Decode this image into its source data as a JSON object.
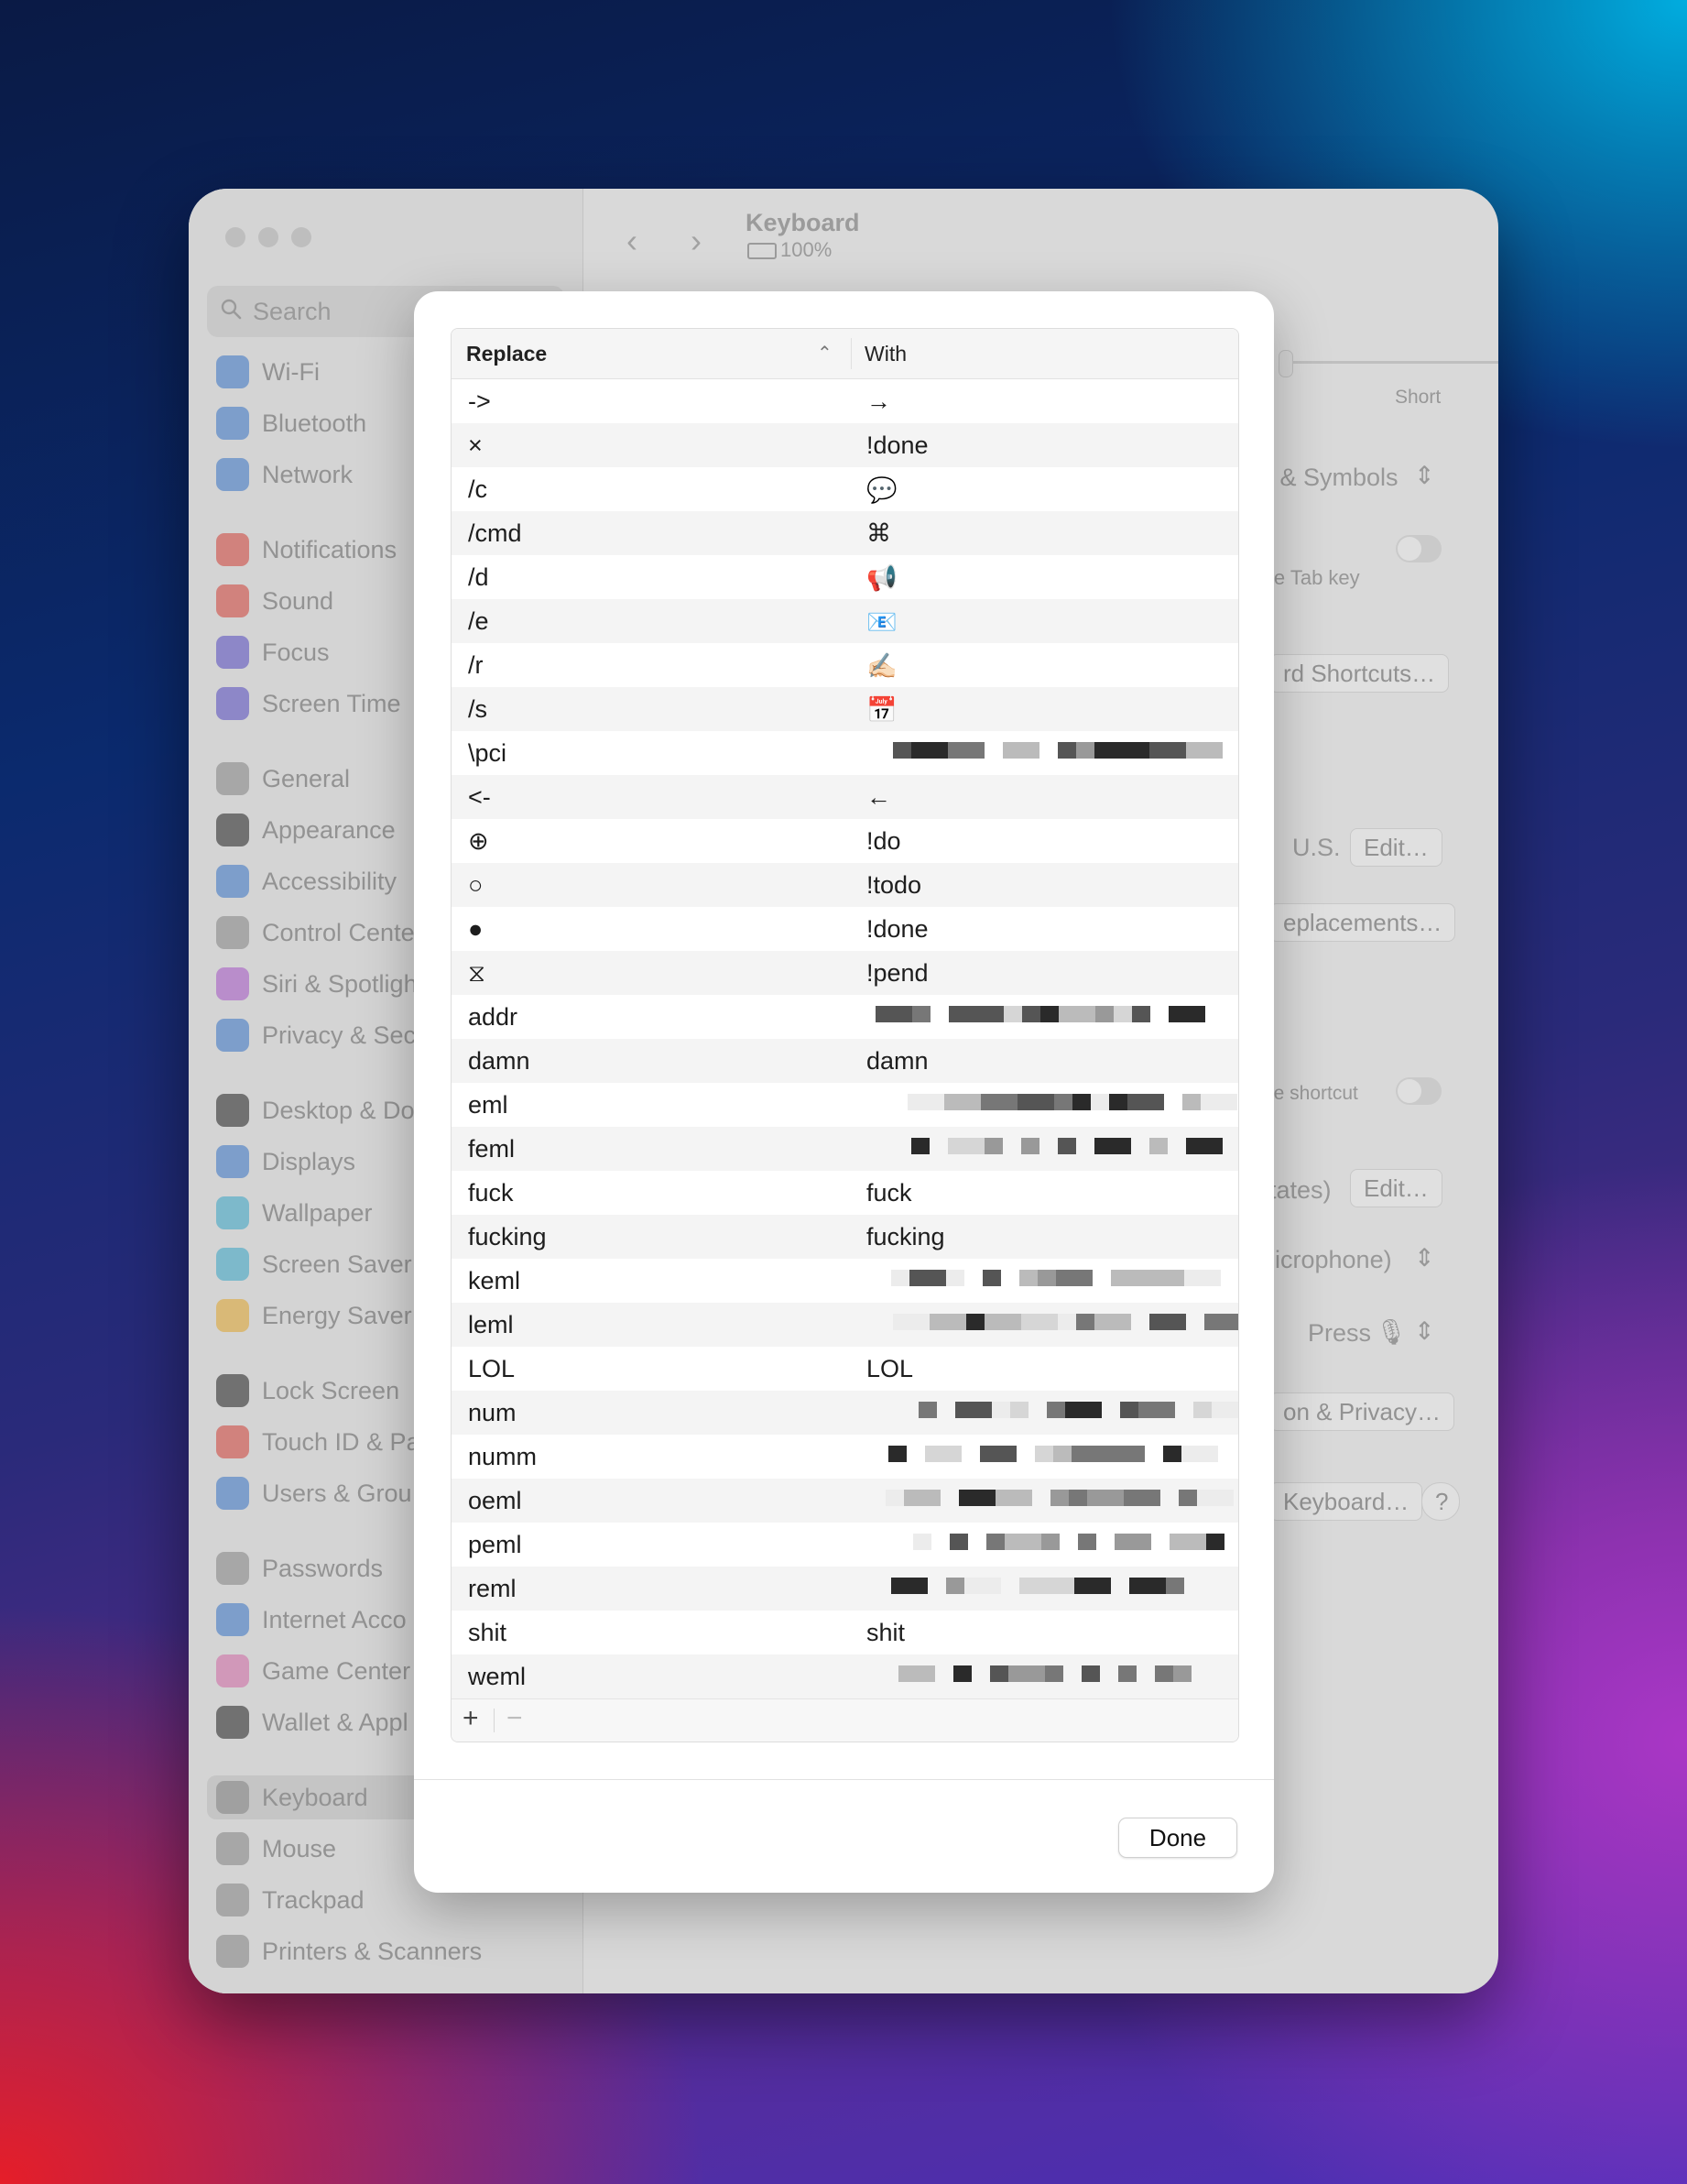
{
  "window": {
    "title": "Keyboard",
    "battery": "100%"
  },
  "sidebar": {
    "search_placeholder": "Search",
    "items": [
      {
        "label": "Wi-Fi",
        "color": "#3a7bd5"
      },
      {
        "label": "Bluetooth",
        "color": "#3a7bd5"
      },
      {
        "label": "Network",
        "color": "#3a7bd5"
      },
      {
        "label": "Notifications",
        "color": "#e0453a"
      },
      {
        "label": "Sound",
        "color": "#e0453a"
      },
      {
        "label": "Focus",
        "color": "#5a4fcf"
      },
      {
        "label": "Screen Time",
        "color": "#5a4fcf"
      },
      {
        "label": "General",
        "color": "#8e8e8e"
      },
      {
        "label": "Appearance",
        "color": "#222222"
      },
      {
        "label": "Accessibility",
        "color": "#3a7bd5"
      },
      {
        "label": "Control Cente",
        "color": "#8e8e8e"
      },
      {
        "label": "Siri & Spotligh",
        "color": "#b05ad6"
      },
      {
        "label": "Privacy & Sec",
        "color": "#3a7bd5"
      },
      {
        "label": "Desktop & Do",
        "color": "#222222"
      },
      {
        "label": "Displays",
        "color": "#3a7bd5"
      },
      {
        "label": "Wallpaper",
        "color": "#3ab0d5"
      },
      {
        "label": "Screen Saver",
        "color": "#3ab0d5"
      },
      {
        "label": "Energy Saver",
        "color": "#f0b030"
      },
      {
        "label": "Lock Screen",
        "color": "#222222"
      },
      {
        "label": "Touch ID & Pa",
        "color": "#e0453a"
      },
      {
        "label": "Users & Grou",
        "color": "#3a7bd5"
      },
      {
        "label": "Passwords",
        "color": "#8e8e8e"
      },
      {
        "label": "Internet Acco",
        "color": "#3a7bd5"
      },
      {
        "label": "Game Center",
        "color": "#e06fb0"
      },
      {
        "label": "Wallet & Appl",
        "color": "#222222"
      },
      {
        "label": "Keyboard",
        "color": "#8e8e8e"
      },
      {
        "label": "Mouse",
        "color": "#8e8e8e"
      },
      {
        "label": "Trackpad",
        "color": "#8e8e8e"
      },
      {
        "label": "Printers & Scanners",
        "color": "#8e8e8e"
      }
    ]
  },
  "background_content": {
    "short_label": "Short",
    "input_sources": "i & Symbols",
    "tab_key": "ie Tab key",
    "shortcuts_button": "rd Shortcuts…",
    "us_label": "U.S.",
    "edit_button_1": "Edit…",
    "replacements_button": "eplacements…",
    "shortcut_label": "ie shortcut",
    "states_label": "tates)",
    "edit_button_2": "Edit…",
    "microphone_label": "licrophone)",
    "press_label": "Press",
    "privacy_button": "on & Privacy…",
    "keyboard_button": "Keyboard…",
    "help_button": "?"
  },
  "dialog": {
    "columns": {
      "replace": "Replace",
      "with": "With"
    },
    "rows": [
      {
        "replace": "->",
        "with": "→"
      },
      {
        "replace": "×",
        "with": "!done"
      },
      {
        "replace": "/c",
        "with": "💬"
      },
      {
        "replace": "/cmd",
        "with": "⌘"
      },
      {
        "replace": "/d",
        "with": "📢"
      },
      {
        "replace": "/e",
        "with": "📧"
      },
      {
        "replace": "/r",
        "with": "✍🏻"
      },
      {
        "replace": "/s",
        "with": "📅"
      },
      {
        "replace": "\\pci",
        "with": "",
        "redacted": true
      },
      {
        "replace": "<-",
        "with": "←"
      },
      {
        "replace": "⊕",
        "with": "!do"
      },
      {
        "replace": "○",
        "with": "!todo"
      },
      {
        "replace": "●",
        "with": "!done"
      },
      {
        "replace": "⧖",
        "with": "!pend"
      },
      {
        "replace": "addr",
        "with": "",
        "redacted": true
      },
      {
        "replace": "damn",
        "with": "damn"
      },
      {
        "replace": "eml",
        "with": "",
        "redacted": true
      },
      {
        "replace": "feml",
        "with": "",
        "redacted": true
      },
      {
        "replace": "fuck",
        "with": "fuck"
      },
      {
        "replace": "fucking",
        "with": "fucking"
      },
      {
        "replace": "keml",
        "with": "",
        "redacted": true
      },
      {
        "replace": "leml",
        "with": "",
        "redacted": true
      },
      {
        "replace": "LOL",
        "with": "LOL"
      },
      {
        "replace": "num",
        "with": "",
        "redacted": true
      },
      {
        "replace": "numm",
        "with": "",
        "redacted": true
      },
      {
        "replace": "oeml",
        "with": "",
        "redacted": true
      },
      {
        "replace": "peml",
        "with": "",
        "redacted": true
      },
      {
        "replace": "reml",
        "with": "",
        "redacted": true
      },
      {
        "replace": "shit",
        "with": "shit"
      },
      {
        "replace": "weml",
        "with": "",
        "redacted": true
      }
    ],
    "add_label": "+",
    "remove_label": "−",
    "done_label": "Done"
  }
}
